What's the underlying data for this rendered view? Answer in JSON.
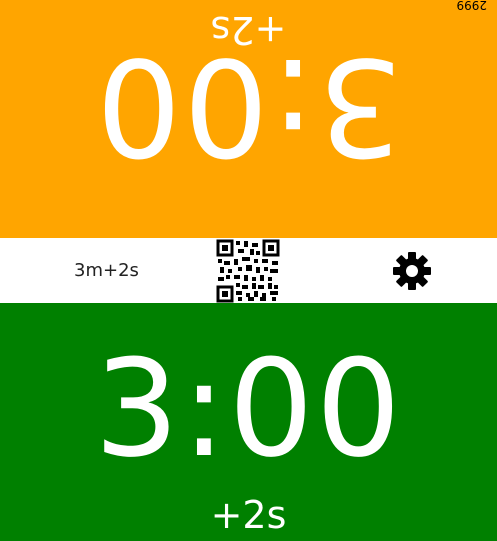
{
  "top_clock": {
    "time": "3:00",
    "increment_label": "+2s",
    "move_count": "2999",
    "background_color": "#ffa500"
  },
  "bottom_clock": {
    "time": "3:00",
    "increment_label": "+2s",
    "background_color": "#008000"
  },
  "control_bar": {
    "time_control": "3m+2s",
    "qr_icon": "qr-code-icon",
    "settings_icon": "gear-icon"
  }
}
